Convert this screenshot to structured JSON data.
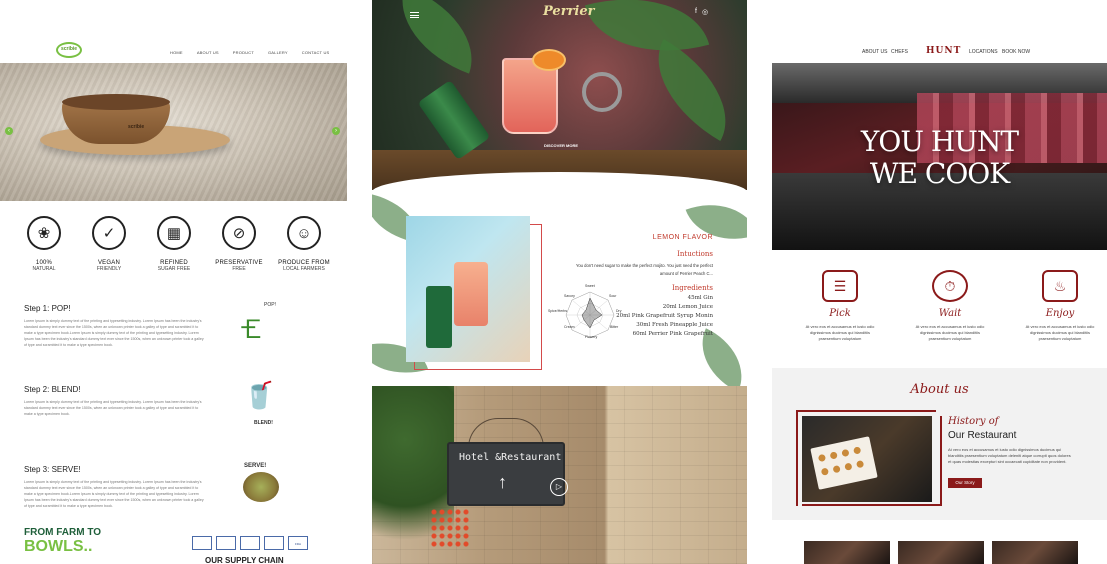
{
  "sites": [
    {
      "name": "scribie",
      "logo_text": "scribie",
      "nav": [
        "HOME",
        "ABOUT US",
        "PRODUCT",
        "GALLERY",
        "CONTACT US"
      ],
      "hero_brand": "scribie",
      "features": [
        {
          "icon": "natural-icon",
          "title": "100%",
          "sub": "NATURAL"
        },
        {
          "icon": "vegan-icon",
          "title": "VEGAN",
          "sub": "FRIENDLY"
        },
        {
          "icon": "sugar-free-icon",
          "title": "REFINED",
          "sub": "SUGAR FREE"
        },
        {
          "icon": "preservative-free-icon",
          "title": "PRESERVATIVE",
          "sub": "FREE"
        },
        {
          "icon": "farmer-icon",
          "title": "PRODUCE FROM",
          "sub": "LOCAL FARMERS"
        }
      ],
      "steps": [
        {
          "title": "Step 1: POP!",
          "text": "Lorem Ipsum is simply dummy text of the printing and typesetting industry. Lorem Ipsum has been the industry's standard dummy text ever since the 1500s, when an unknown printer took a galley of type and scrambled it to make a type specimen book.Lorem Ipsum is simply dummy text of the printing and typesetting industry. Lorem Ipsum has been the industry's standard dummy text ever since the 1500s, when an unknown printer took a galley of type and scrambled it to make a type specimen book."
        },
        {
          "title": "Step 2: BLEND!",
          "text": "Lorem Ipsum is simply dummy text of the printing and typesetting industry. Lorem Ipsum has been the industry's standard dummy text ever since the 1500s, when an unknown printer took a galley of type and scrambled it to make a type specimen book."
        },
        {
          "title": "Step 3: SERVE!",
          "text": "Lorem Ipsum is simply dummy text of the printing and typesetting industry. Lorem Ipsum has been the industry's standard dummy text ever since the 1500s, when an unknown printer took a galley of type and scrambled it to make a type specimen book.Lorem Ipsum is simply dummy text of the printing and typesetting industry. Lorem Ipsum has been the industry's standard dummy text ever since the 1500s, when an unknown printer took a galley of type and scrambled it to make a type specimen book."
        }
      ],
      "step_images": [
        "POP!",
        "BLEND!",
        "SERVE!"
      ],
      "farm_line1": "FROM FARM TO",
      "farm_line2": "BOWLS..",
      "cert_labels": [
        "",
        "",
        "",
        "",
        "FDA"
      ],
      "supply_chain": "OUR SUPPLY CHAIN",
      "accent": "#79c043"
    },
    {
      "name": "perrier",
      "logo_text": "Perrier",
      "social": [
        "f",
        "◎"
      ],
      "discover": "DISCOVER MORE",
      "flavor_title": "LEMON FLAVOR",
      "instructions_label": "Intuctions",
      "instructions_text": "You don't need sugar to make the perfect mojito. You just need the perfect amount of Perrier Peach C...",
      "ingredients_label": "Ingredients",
      "ingredients": [
        "45ml Gin",
        "20ml Lemon Juice",
        "20ml Pink Grapefruit Syrup Monin",
        "30ml Fresh Pineapple Juice",
        "60ml Perrier Pink Grapefruit"
      ],
      "radar_labels": [
        "Sweet",
        "Sour",
        "Dry",
        "Bitter",
        "Flowery",
        "Cream",
        "Spice/Herbs",
        "Savory"
      ],
      "sign_text": "Hotel &Restaurant",
      "sign_arrow": "↑",
      "play_icon": "▷",
      "accent": "#c0392b"
    },
    {
      "name": "hunt",
      "nav_left": [
        "ABOUT US",
        "CHEFS"
      ],
      "logo_text": "HUNT",
      "nav_right": [
        "LOCATIONS",
        "BOOK NOW"
      ],
      "hero_line1": "YOU HUNT",
      "hero_line2": "WE COOK",
      "steps": [
        {
          "icon": "menu-icon",
          "glyph": "☰",
          "title": "Pick",
          "text": "At vero eos et accusamus et iusto odio dignissimos ducimus qui blanditiis praesentium voluptatum"
        },
        {
          "icon": "stopwatch-icon",
          "glyph": "⏱",
          "title": "Wait",
          "text": "At vero eos et accusamus et iusto odio dignissimos ducimus qui blanditiis praesentium voluptatum"
        },
        {
          "icon": "chef-icon",
          "glyph": "♨",
          "title": "Enjoy",
          "text": "At vero eos et accusamus et iusto odio dignissimos ducimus qui blanditiis praesentium voluptatum"
        }
      ],
      "about_heading": "About us",
      "history_label": "History of",
      "history_title": "Our Restaurant",
      "history_text": "At vero eos et accusamus et iusto odio dignissimos ducimus qui blanditiis praesentium voluptatum deleniti atque corrupti quos dolores et quas molestias excepturi sint occaecati cupiditate non provident.",
      "story_button": "Our Story",
      "accent": "#8b1a1a"
    }
  ]
}
